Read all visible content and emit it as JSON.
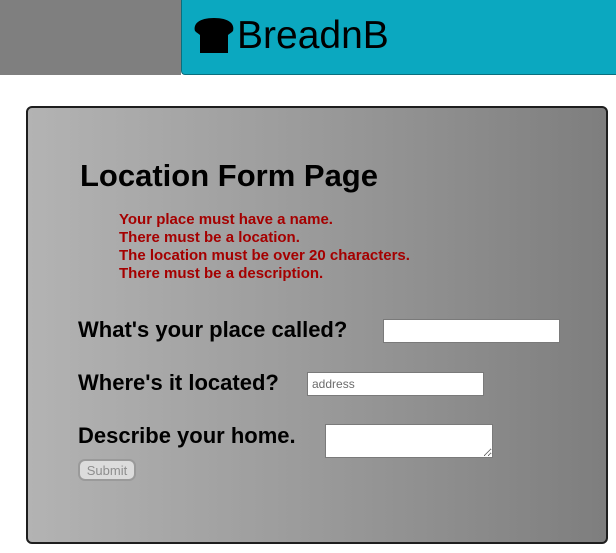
{
  "header": {
    "brand_name": "BreadnB",
    "brand_icon": "bread-icon",
    "accent_color": "#0ba8c0"
  },
  "form": {
    "title": "Location Form Page",
    "errors": [
      "Your place must have a name.",
      "There must be a location.",
      "The location must be over 20 characters.",
      "There must be a description."
    ],
    "name_label": "What's your place called?",
    "name_value": "",
    "location_label": "Where's it located?",
    "location_placeholder": "address",
    "location_value": "",
    "description_label": "Describe your home.",
    "description_value": "",
    "submit_label": "Submit",
    "error_color": "#a50000"
  }
}
